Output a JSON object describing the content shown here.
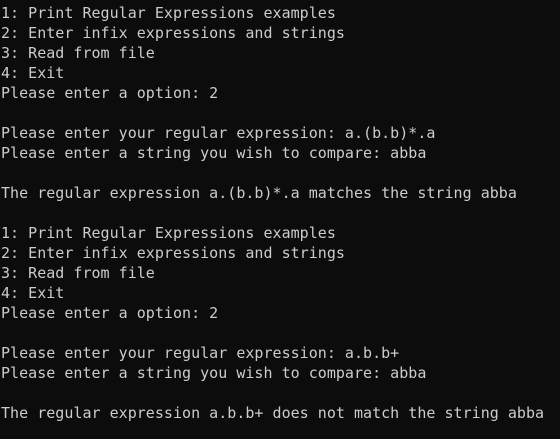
{
  "console": {
    "lines": [
      "1: Print Regular Expressions examples",
      "2: Enter infix expressions and strings",
      "3: Read from file",
      "4: Exit",
      "Please enter a option: 2",
      "",
      "Please enter your regular expression: a.(b.b)*.a",
      "Please enter a string you wish to compare: abba",
      "",
      "The regular expression a.(b.b)*.a matches the string abba",
      "",
      "1: Print Regular Expressions examples",
      "2: Enter infix expressions and strings",
      "3: Read from file",
      "4: Exit",
      "Please enter a option: 2",
      "",
      "Please enter your regular expression: a.b.b+",
      "Please enter a string you wish to compare: abba",
      "",
      "The regular expression a.b.b+ does not match the string abba"
    ]
  },
  "colors": {
    "background": "#0c0c0c",
    "foreground": "#cccccc"
  }
}
